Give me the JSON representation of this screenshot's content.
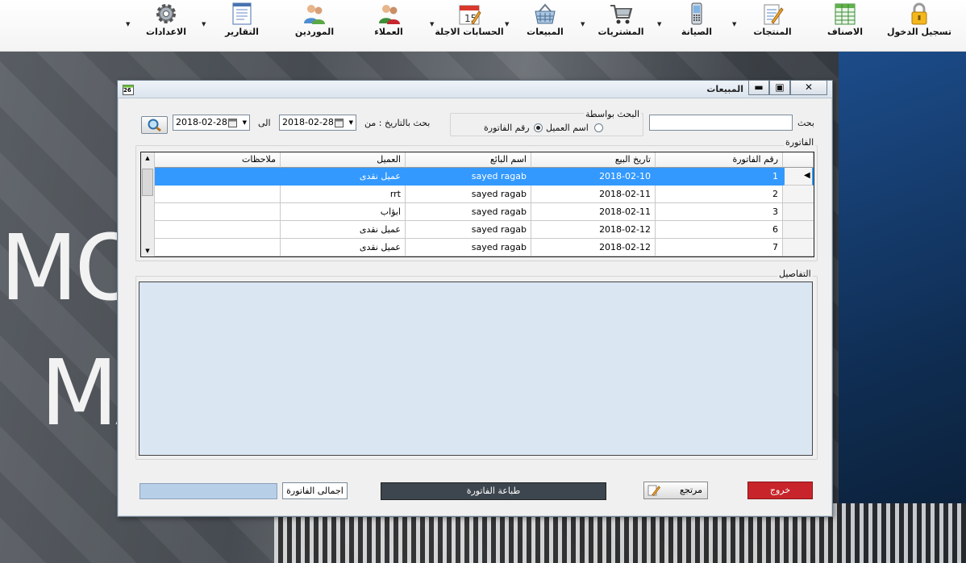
{
  "toolbar": {
    "items": [
      {
        "label": "تسجيل الدخول",
        "icon": "lock-icon"
      },
      {
        "label": "الاصناف",
        "icon": "table-icon"
      },
      {
        "label": "المنتجات",
        "icon": "notepad-pencil-icon"
      },
      {
        "label": "الصيانة",
        "icon": "mobile-phone-icon"
      },
      {
        "label": "المشتريات",
        "icon": "shopping-cart-icon"
      },
      {
        "label": "المبيعات",
        "icon": "shopping-basket-icon"
      },
      {
        "label": "الحسابات الاجلة",
        "icon": "calendar-icon"
      },
      {
        "label": "العملاء",
        "icon": "customers-icon"
      },
      {
        "label": "الموردين",
        "icon": "suppliers-icon"
      },
      {
        "label": "التقارير",
        "icon": "report-icon"
      },
      {
        "label": "الاعدادات",
        "icon": "gear-icon"
      }
    ]
  },
  "background": {
    "line1": "MOB",
    "line2": "MA"
  },
  "window": {
    "title": "المبيعات",
    "icon_text": "26",
    "minimize": "▬",
    "maximize": "▣",
    "close": "✕"
  },
  "search": {
    "label": "بحث",
    "value": "",
    "by_label": "البحث بواسطة",
    "option_invoice": "رقم الفاتورة",
    "option_customer": "اسم العميل",
    "selected": "رقم الفاتورة",
    "date_label": "بحث بالتاريخ : من",
    "date_from": "2018-02-28",
    "to_label": "الى",
    "date_to": "2018-02-28"
  },
  "invoice_section": {
    "title": "الفاتورة",
    "columns": [
      "رقم الفاتورة",
      "تاريخ البيع",
      "اسم البائع",
      "العميل",
      "ملاحظات"
    ],
    "rows": [
      {
        "id": "1",
        "date": "2018-02-10",
        "seller": "sayed ragab",
        "customer": "عميل نقدى",
        "notes": ""
      },
      {
        "id": "2",
        "date": "2018-02-11",
        "seller": "sayed ragab",
        "customer": "rrt",
        "notes": ""
      },
      {
        "id": "3",
        "date": "2018-02-11",
        "seller": "sayed ragab",
        "customer": "ابؤاب",
        "notes": ""
      },
      {
        "id": "6",
        "date": "2018-02-12",
        "seller": "sayed ragab",
        "customer": "عميل نقدى",
        "notes": ""
      },
      {
        "id": "7",
        "date": "2018-02-12",
        "seller": "sayed ragab",
        "customer": "عميل نقدى",
        "notes": ""
      }
    ],
    "selected_row": 0
  },
  "details_section": {
    "title": "التفاصيل"
  },
  "footer": {
    "exit": "خروج",
    "return": "مرتجع",
    "print": "طباعة الفاتورة",
    "total_label": "اجمالى الفاتورة",
    "total_value": ""
  },
  "colors": {
    "selected_row": "#3399ff",
    "details_bg": "#dae6f2",
    "exit_button": "#c8242b",
    "print_button": "#3d464e",
    "total_box": "#b8cfe8"
  }
}
